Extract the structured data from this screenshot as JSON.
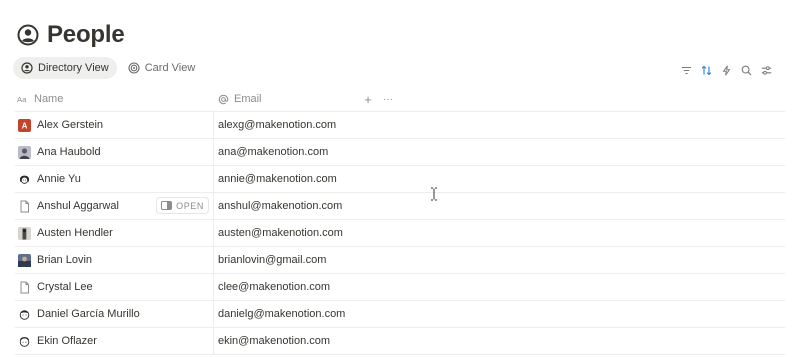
{
  "page": {
    "title": "People",
    "icon": "person-circle-icon"
  },
  "views": [
    {
      "label": "Directory View",
      "icon": "person-circle-icon",
      "active": true
    },
    {
      "label": "Card View",
      "icon": "target-icon",
      "active": false
    }
  ],
  "toolbar": {
    "items": [
      "filter-icon",
      "sort-icon",
      "lightning-icon",
      "search-icon",
      "settings-sliders-icon"
    ]
  },
  "table": {
    "columns": [
      {
        "label": "Name",
        "icon": "text-property-icon"
      },
      {
        "label": "Email",
        "icon": "at-sign-icon"
      }
    ],
    "add_property": "+",
    "more": "···",
    "open_label": "OPEN",
    "rows": [
      {
        "name": "Alex Gerstein",
        "email": "alexg@makenotion.com",
        "avatar": "letter-a-avatar"
      },
      {
        "name": "Ana Haubold",
        "email": "ana@makenotion.com",
        "avatar": "photo-avatar"
      },
      {
        "name": "Annie Yu",
        "email": "annie@makenotion.com",
        "avatar": "sketch-face-avatar"
      },
      {
        "name": "Anshul Aggarwal",
        "email": "anshul@makenotion.com",
        "avatar": "page-icon",
        "hover": true
      },
      {
        "name": "Austen Hendler",
        "email": "austen@makenotion.com",
        "avatar": "photo-avatar"
      },
      {
        "name": "Brian Lovin",
        "email": "brianlovin@gmail.com",
        "avatar": "photo-avatar"
      },
      {
        "name": "Crystal Lee",
        "email": "clee@makenotion.com",
        "avatar": "page-icon"
      },
      {
        "name": "Daniel García Murillo",
        "email": "danielg@makenotion.com",
        "avatar": "sketch-face-avatar"
      },
      {
        "name": "Ekin Oflazer",
        "email": "ekin@makenotion.com",
        "avatar": "sketch-face-avatar"
      }
    ]
  }
}
